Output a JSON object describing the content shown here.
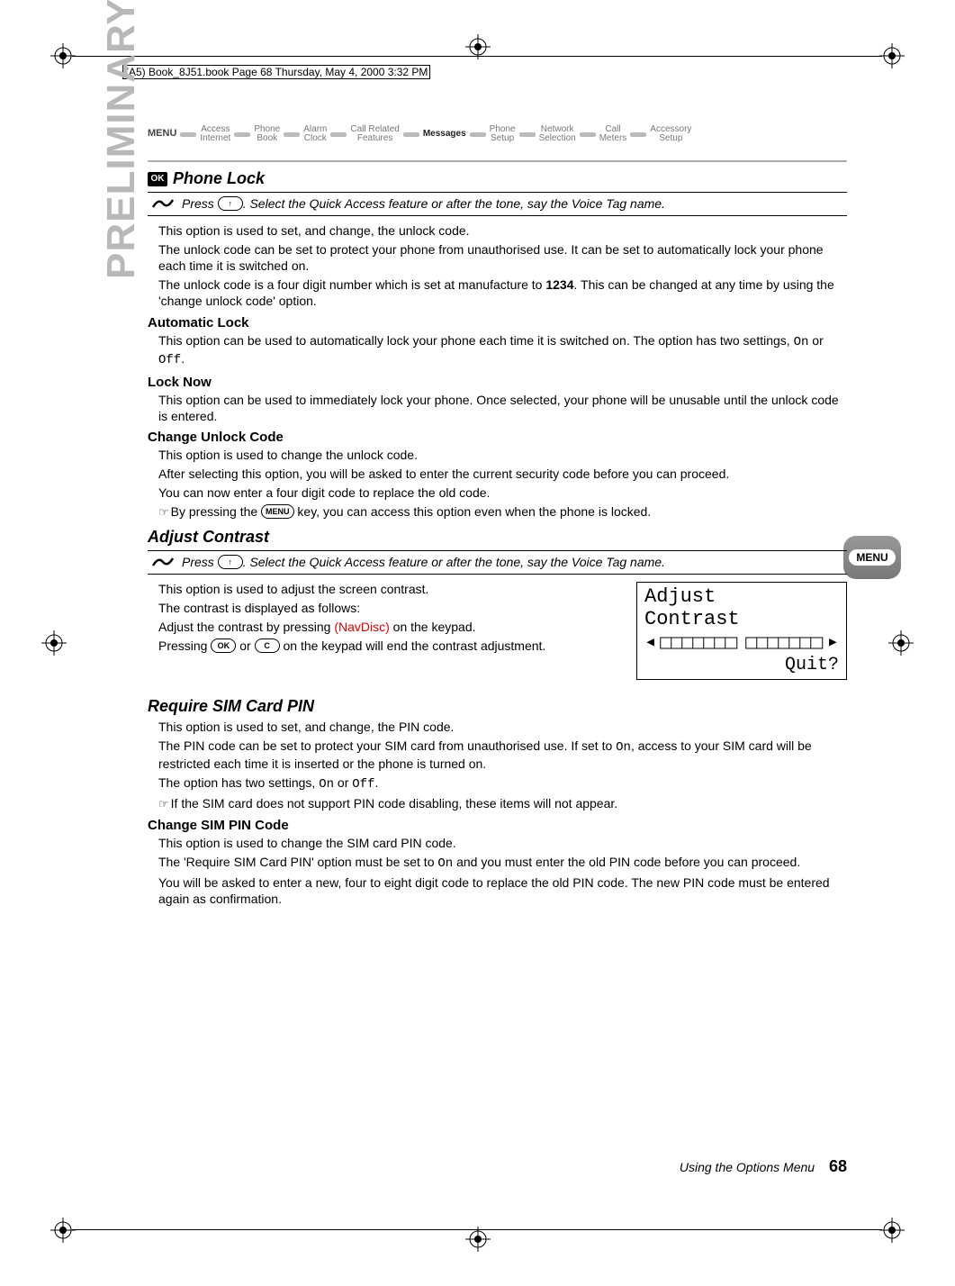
{
  "page_slug": "(A5) Book_8J51.book  Page 68  Thursday, May 4, 2000  3:32 PM",
  "menubar": {
    "menu_label": "MENU",
    "items": [
      {
        "top": "Access",
        "bottom": "Internet",
        "active": false
      },
      {
        "top": "Phone",
        "bottom": "Book",
        "active": false
      },
      {
        "top": "Alarm",
        "bottom": "Clock",
        "active": false
      },
      {
        "top": "Call Related",
        "bottom": "Features",
        "active": false
      },
      {
        "top": "Messages",
        "bottom": "",
        "active": true
      },
      {
        "top": "Phone",
        "bottom": "Setup",
        "active": false
      },
      {
        "top": "Network",
        "bottom": "Selection",
        "active": false
      },
      {
        "top": "Call",
        "bottom": "Meters",
        "active": false
      },
      {
        "top": "Accessory",
        "bottom": "Setup",
        "active": false
      }
    ]
  },
  "preliminary_label": "PRELIMINARY",
  "menu_tab_label": "MENU",
  "ok_badge": "OK",
  "phone_lock": {
    "heading": "Phone Lock",
    "qa_press_prefix": "Press ",
    "qa_key": "↑",
    "qa_press_suffix": ". Select the Quick Access feature or after the tone, say the Voice Tag name.",
    "p1": "This option is used to set, and change, the unlock code.",
    "p2": "The unlock code can be set to protect your phone from unauthorised use. It can be set to automatically lock your phone each time it is switched on.",
    "p3_a": "The unlock code is a four digit number which is set at manufacture to ",
    "p3_bold": "1234",
    "p3_b": ". This can be changed at any time by using the 'change unlock code' option.",
    "auto_lock_heading": "Automatic Lock",
    "auto_lock_p_a": "This option can be used to automatically lock your phone each time it is switched on. The option has two settings, ",
    "auto_lock_on": "On",
    "auto_lock_mid": " or ",
    "auto_lock_off": "Off",
    "auto_lock_end": ".",
    "lock_now_heading": "Lock Now",
    "lock_now_p": "This option can be used to immediately lock your phone. Once selected, your phone will be unusable until the unlock code is entered.",
    "change_unlock_heading": "Change Unlock Code",
    "cuc_p1": "This option is used to change the unlock code.",
    "cuc_p2": "After selecting this option, you will be asked to enter the current security code before you can proceed.",
    "cuc_p3": "You can now enter a four digit code to replace the old code.",
    "cuc_note_a": "By pressing the ",
    "cuc_note_key": "MENU",
    "cuc_note_b": " key, you can access this option even when the phone is locked."
  },
  "adjust_contrast": {
    "heading": "Adjust Contrast",
    "qa_press_prefix": "Press ",
    "qa_key": "↑",
    "qa_press_suffix": ". Select the Quick Access feature or after the tone, say the Voice Tag name.",
    "p1": "This option is used to adjust the screen contrast.",
    "p2": "The contrast is displayed as follows:",
    "p3_a": "Adjust the contrast by pressing ",
    "p3_nav": "(NavDisc)",
    "p3_b": " on the keypad.",
    "p4_a": "Pressing ",
    "p4_key1": "OK",
    "p4_mid": " or ",
    "p4_key2": "C",
    "p4_b": " on the keypad will end the contrast adjustment.",
    "lcd": {
      "line1": "Adjust",
      "line2": "Contrast",
      "quit": "Quit?"
    }
  },
  "require_sim": {
    "heading": "Require SIM Card PIN",
    "p1": "This option is used to set, and change, the PIN code.",
    "p2_a": "The PIN code can be set to protect your SIM card from unauthorised use. If set to ",
    "p2_on": "On",
    "p2_b": ", access to your SIM card will be restricted each time it is inserted or the phone is turned on.",
    "p3_a": "The option has two settings, ",
    "p3_on": "On",
    "p3_mid": " or ",
    "p3_off": "Off",
    "p3_end": ".",
    "note": "If the SIM card does not support PIN code disabling, these items will not appear.",
    "change_sim_heading": "Change SIM PIN Code",
    "csp_p1": "This option is used to change the SIM card PIN code.",
    "csp_p2_a": "The 'Require SIM Card PIN' option must be set to ",
    "csp_p2_on": "On",
    "csp_p2_b": " and you must enter the old PIN code before you can proceed.",
    "csp_p3": "You will be asked to enter a new, four to eight digit code to replace the old PIN code. The new PIN code must be entered again as confirmation."
  },
  "footer": {
    "label": "Using the Options Menu",
    "page": "68"
  }
}
